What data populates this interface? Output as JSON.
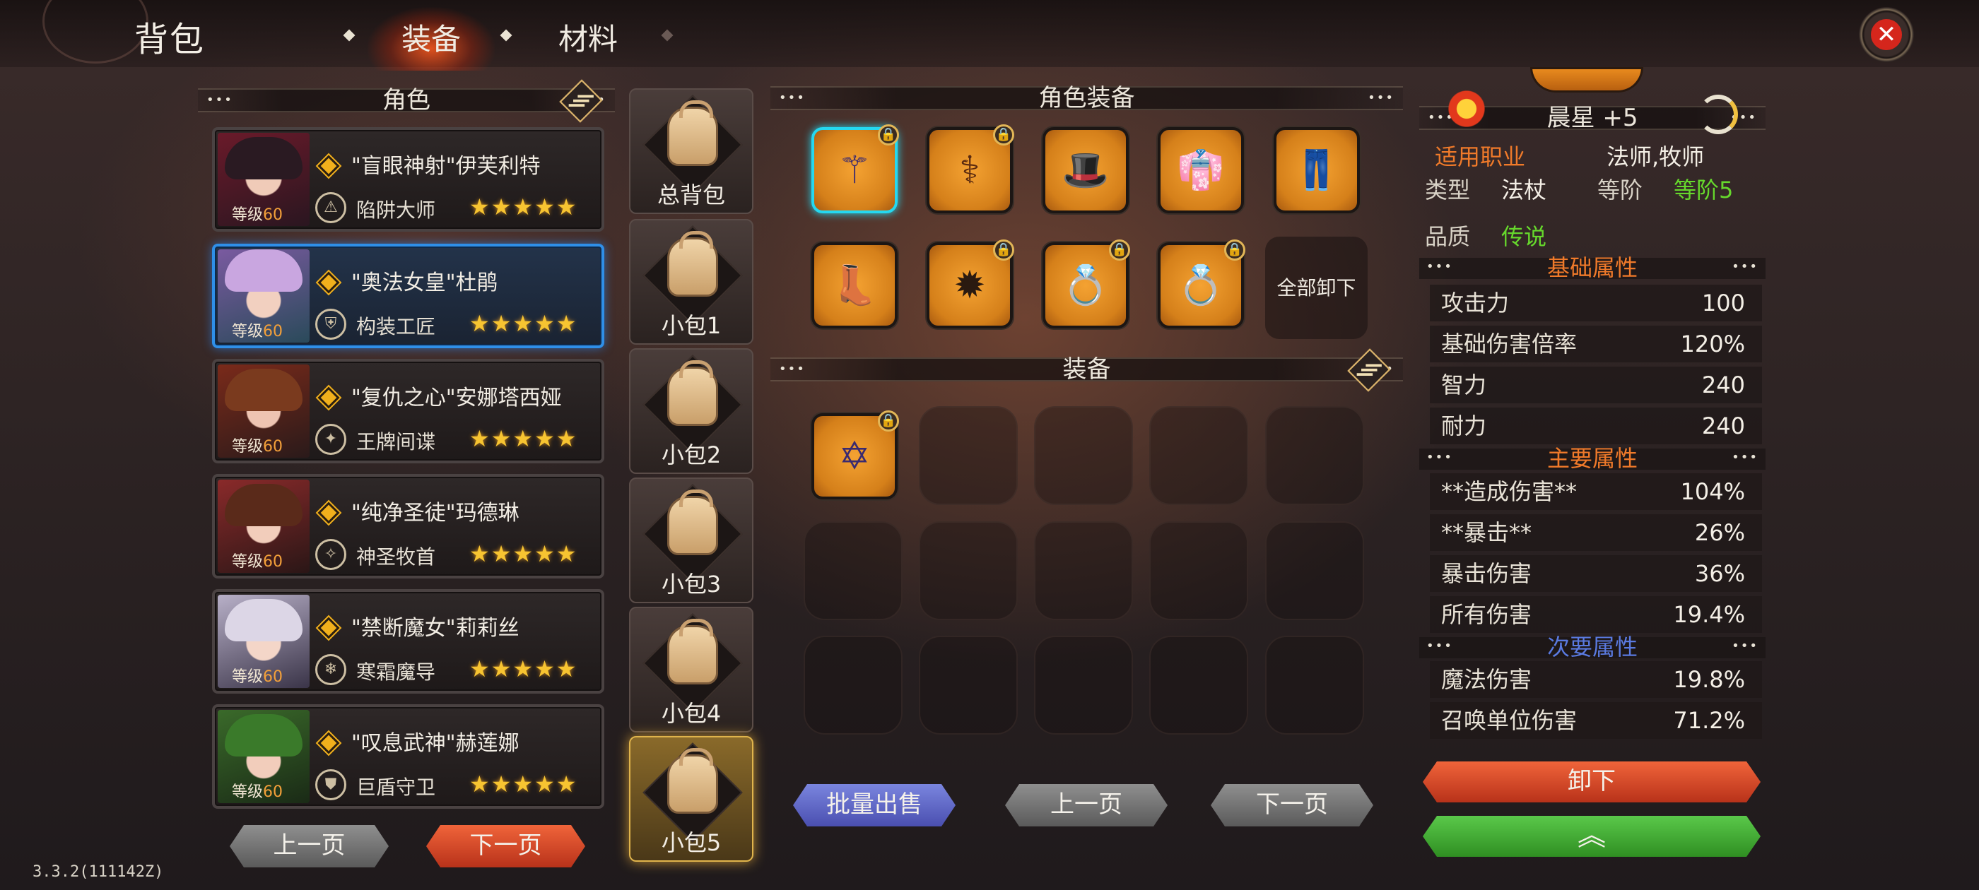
{
  "header": {
    "title": "背包",
    "tabs": [
      {
        "label": "装备",
        "active": true
      },
      {
        "label": "材料",
        "active": false
      }
    ]
  },
  "roles": {
    "section_title": "角色",
    "characters": [
      {
        "name": "\"盲眼神射\"伊芙利特",
        "class": "陷阱大师",
        "level_label": "等级",
        "level": "60",
        "stars": "★★★★★"
      },
      {
        "name": "\"奥法女皇\"杜鹃",
        "class": "构装工匠",
        "level_label": "等级",
        "level": "60",
        "stars": "★★★★★"
      },
      {
        "name": "\"复仇之心\"安娜塔西娅",
        "class": "王牌间谍",
        "level_label": "等级",
        "level": "60",
        "stars": "★★★★★"
      },
      {
        "name": "\"纯净圣徒\"玛德琳",
        "class": "神圣牧首",
        "level_label": "等级",
        "level": "60",
        "stars": "★★★★★"
      },
      {
        "name": "\"禁断魔女\"莉莉丝",
        "class": "寒霜魔导",
        "level_label": "等级",
        "level": "60",
        "stars": "★★★★★"
      },
      {
        "name": "\"叹息武神\"赫莲娜",
        "class": "巨盾守卫",
        "level_label": "等级",
        "level": "60",
        "stars": "★★★★★"
      }
    ],
    "prev_label": "上一页",
    "next_label": "下一页"
  },
  "bags": [
    {
      "label": "总背包"
    },
    {
      "label": "小包1"
    },
    {
      "label": "小包2"
    },
    {
      "label": "小包3"
    },
    {
      "label": "小包4"
    },
    {
      "label": "小包5"
    }
  ],
  "role_equipment": {
    "section_title": "角色装备",
    "unequip_all_label": "全部卸下"
  },
  "inventory": {
    "section_title": "装备",
    "batch_sell_label": "批量出售",
    "prev_label": "上一页",
    "next_label": "下一页"
  },
  "detail": {
    "item_name": "晨星 +5",
    "classes_label": "适用职业",
    "classes_value": "法师,牧师",
    "type_label": "类型",
    "type_value": "法杖",
    "rank_label": "等阶",
    "rank_value": "等阶5",
    "quality_label": "品质",
    "quality_value": "传说",
    "base_title": "基础属性",
    "base_stats": [
      {
        "k": "攻击力",
        "v": "100"
      },
      {
        "k": "基础伤害倍率",
        "v": "120%"
      },
      {
        "k": "智力",
        "v": "240"
      },
      {
        "k": "耐力",
        "v": "240"
      }
    ],
    "main_title": "主要属性",
    "main_stats": [
      {
        "k": "**造成伤害**",
        "v": "104%"
      },
      {
        "k": "**暴击**",
        "v": "26%"
      },
      {
        "k": "暴击伤害",
        "v": "36%"
      },
      {
        "k": "所有伤害",
        "v": "19.4%"
      }
    ],
    "secondary_title": "次要属性",
    "secondary_stats": [
      {
        "k": "魔法伤害",
        "v": "19.8%"
      },
      {
        "k": "召唤单位伤害",
        "v": "71.2%"
      }
    ],
    "unequip_label": "卸下",
    "upgrade_icon": "chevron-up-icon"
  },
  "version": "3.3.2(111142Z)",
  "colors": {
    "accent_orange": "#f07a2a",
    "legend_green": "#66d82c",
    "selected_blue": "#2f8fe8",
    "slot_orange": "#e58a22"
  }
}
